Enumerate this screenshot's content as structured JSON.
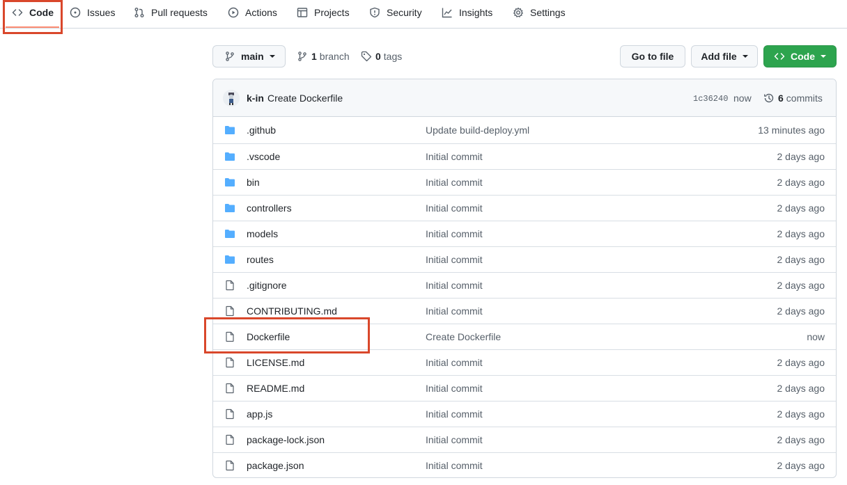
{
  "nav": {
    "tabs": [
      {
        "label": "Code",
        "icon": "code-icon",
        "active": true
      },
      {
        "label": "Issues",
        "icon": "issue-opened-icon"
      },
      {
        "label": "Pull requests",
        "icon": "git-pull-request-icon"
      },
      {
        "label": "Actions",
        "icon": "play-icon"
      },
      {
        "label": "Projects",
        "icon": "table-icon"
      },
      {
        "label": "Security",
        "icon": "shield-icon"
      },
      {
        "label": "Insights",
        "icon": "graph-icon"
      },
      {
        "label": "Settings",
        "icon": "gear-icon"
      }
    ]
  },
  "branchbar": {
    "branch": "main",
    "branch_count": "1",
    "branch_word": "branch",
    "tag_count": "0",
    "tag_word": "tags",
    "go_to_file": "Go to file",
    "add_file": "Add file",
    "code_button": "Code"
  },
  "latest_commit": {
    "author": "k-in",
    "message": "Create Dockerfile",
    "sha": "1c36240",
    "time": "now",
    "commit_count": "6",
    "commit_word": "commits"
  },
  "files": [
    {
      "name": ".github",
      "type": "dir",
      "message": "Update build-deploy.yml",
      "time": "13 minutes ago"
    },
    {
      "name": ".vscode",
      "type": "dir",
      "message": "Initial commit",
      "time": "2 days ago"
    },
    {
      "name": "bin",
      "type": "dir",
      "message": "Initial commit",
      "time": "2 days ago"
    },
    {
      "name": "controllers",
      "type": "dir",
      "message": "Initial commit",
      "time": "2 days ago"
    },
    {
      "name": "models",
      "type": "dir",
      "message": "Initial commit",
      "time": "2 days ago"
    },
    {
      "name": "routes",
      "type": "dir",
      "message": "Initial commit",
      "time": "2 days ago"
    },
    {
      "name": ".gitignore",
      "type": "file",
      "message": "Initial commit",
      "time": "2 days ago"
    },
    {
      "name": "CONTRIBUTING.md",
      "type": "file",
      "message": "Initial commit",
      "time": "2 days ago"
    },
    {
      "name": "Dockerfile",
      "type": "file",
      "message": "Create Dockerfile",
      "time": "now"
    },
    {
      "name": "LICENSE.md",
      "type": "file",
      "message": "Initial commit",
      "time": "2 days ago"
    },
    {
      "name": "README.md",
      "type": "file",
      "message": "Initial commit",
      "time": "2 days ago"
    },
    {
      "name": "app.js",
      "type": "file",
      "message": "Initial commit",
      "time": "2 days ago"
    },
    {
      "name": "package-lock.json",
      "type": "file",
      "message": "Initial commit",
      "time": "2 days ago"
    },
    {
      "name": "package.json",
      "type": "file",
      "message": "Initial commit",
      "time": "2 days ago"
    }
  ],
  "colors": {
    "folder": "#54aeff",
    "file_icon": "#57606a",
    "active_underline": "#fd8c73",
    "annotation": "#d9472b",
    "green_button": "#2da44e"
  }
}
